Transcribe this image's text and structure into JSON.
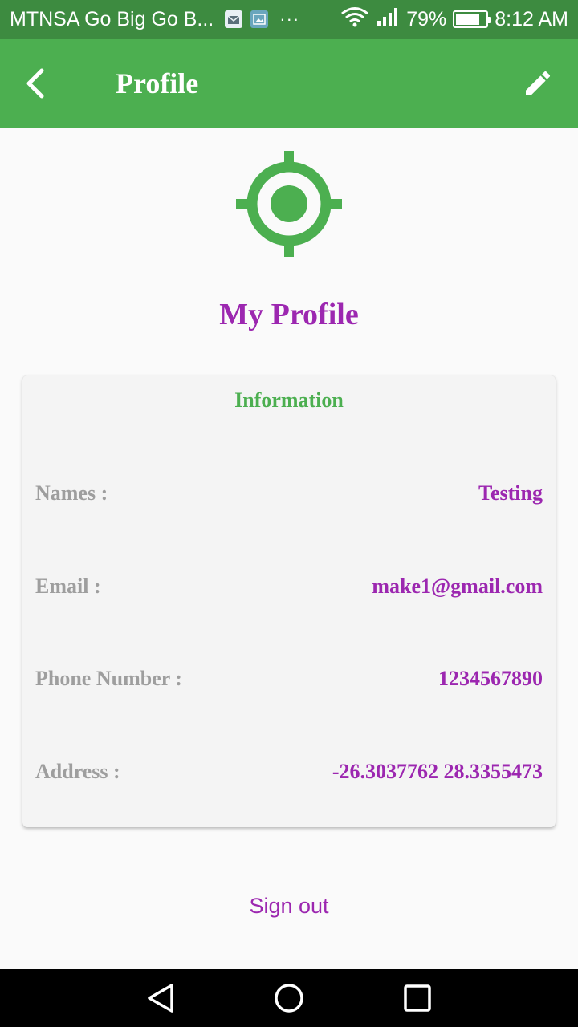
{
  "status_bar": {
    "carrier": "MTNSA Go Big Go B...",
    "dots": "···",
    "battery_percent": "79%",
    "battery_level": 0.79,
    "time": "8:12 AM",
    "icons": [
      "mail-notification-icon",
      "image-notification-icon",
      "wifi-icon",
      "signal-icon",
      "battery-icon"
    ]
  },
  "app_bar": {
    "title": "Profile",
    "back_icon": "back-arrow-icon",
    "edit_icon": "pencil-icon"
  },
  "header": {
    "icon": "location-target-icon",
    "title": "My Profile"
  },
  "info_card": {
    "heading": "Information",
    "rows": [
      {
        "label": "Names :",
        "value": "Testing"
      },
      {
        "label": "Email :",
        "value": "make1@gmail.com"
      },
      {
        "label": "Phone Number :",
        "value": "1234567890"
      },
      {
        "label": "Address :",
        "value": "-26.3037762 28.3355473"
      }
    ]
  },
  "actions": {
    "sign_out": "Sign out"
  },
  "nav_bar": {
    "icons": [
      "back-triangle-icon",
      "home-circle-icon",
      "recents-square-icon"
    ]
  },
  "colors": {
    "status_bar": "#3d8b40",
    "app_bar": "#4caf50",
    "accent_purple": "#9c27b0",
    "label_gray": "#9e9e9e",
    "card_bg": "#f4f4f4"
  }
}
